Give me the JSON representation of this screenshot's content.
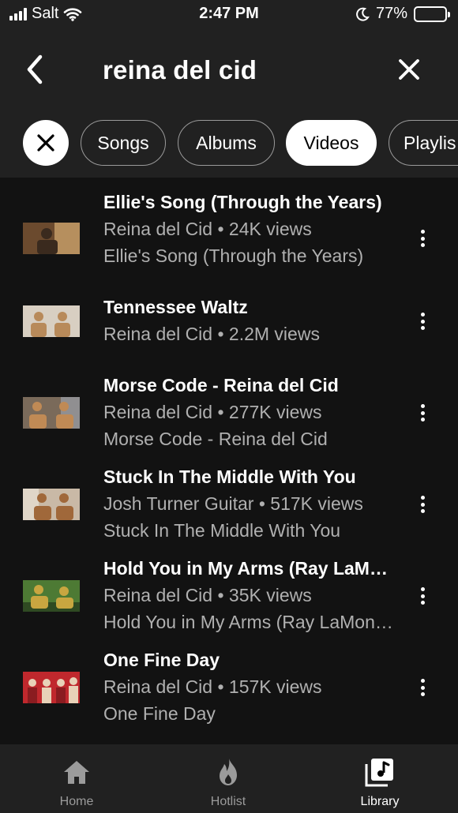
{
  "status_bar": {
    "carrier": "Salt",
    "time": "2:47 PM",
    "battery": "77%",
    "battery_level": 0.77
  },
  "search": {
    "query": "reina del cid",
    "back_icon": "chevron-left-icon",
    "clear_icon": "close-icon"
  },
  "filters": {
    "clear_icon": "close-icon",
    "chips": [
      {
        "label": "Songs",
        "active": false
      },
      {
        "label": "Albums",
        "active": false
      },
      {
        "label": "Videos",
        "active": true
      },
      {
        "label": "Playlis",
        "active": false
      }
    ]
  },
  "results": [
    {
      "title": "Ellie's Song (Through the Years)",
      "subtitle": "Reina del Cid • 24K views",
      "subtitle2": "Ellie's Song (Through the Years)",
      "thumb_colors": [
        "#6b4a2e",
        "#c9a06a",
        "#3a2a1e"
      ]
    },
    {
      "title": "Tennessee Waltz",
      "subtitle": "Reina del Cid • 2.2M views",
      "subtitle2": "",
      "thumb_colors": [
        "#d8cfc2",
        "#b88a5a",
        "#eae3d8"
      ]
    },
    {
      "title": "Morse Code - Reina del Cid",
      "subtitle": "Reina del Cid • 277K views",
      "subtitle2": "Morse Code - Reina del Cid",
      "thumb_colors": [
        "#7a6a5a",
        "#c08a55",
        "#9aa0a8"
      ]
    },
    {
      "title": "Stuck In The Middle With You",
      "subtitle": "Josh Turner Guitar • 517K views",
      "subtitle2": "Stuck In The Middle With You",
      "thumb_colors": [
        "#c9b9a6",
        "#a0683a",
        "#e0d6c8"
      ]
    },
    {
      "title": "Hold You in My Arms (Ray LaMontagne)",
      "subtitle": "Reina del Cid • 35K views",
      "subtitle2": "Hold You in My Arms (Ray LaMontagne)",
      "thumb_colors": [
        "#4d7a34",
        "#c8a640",
        "#2f4a22"
      ]
    },
    {
      "title": "One Fine Day",
      "subtitle": "Reina del Cid • 157K views",
      "subtitle2": "One Fine Day",
      "thumb_colors": [
        "#c0282d",
        "#e8d2b8",
        "#8a1c20"
      ]
    }
  ],
  "nav": {
    "tabs": [
      {
        "label": "Home",
        "icon": "home-icon",
        "active": false
      },
      {
        "label": "Hotlist",
        "icon": "flame-icon",
        "active": false
      },
      {
        "label": "Library",
        "icon": "library-icon",
        "active": true
      }
    ]
  },
  "colors": {
    "header_bg": "#212121",
    "list_bg": "#121212",
    "secondary_text": "#b0b0b0",
    "inactive_icon": "#9b9b9b"
  }
}
